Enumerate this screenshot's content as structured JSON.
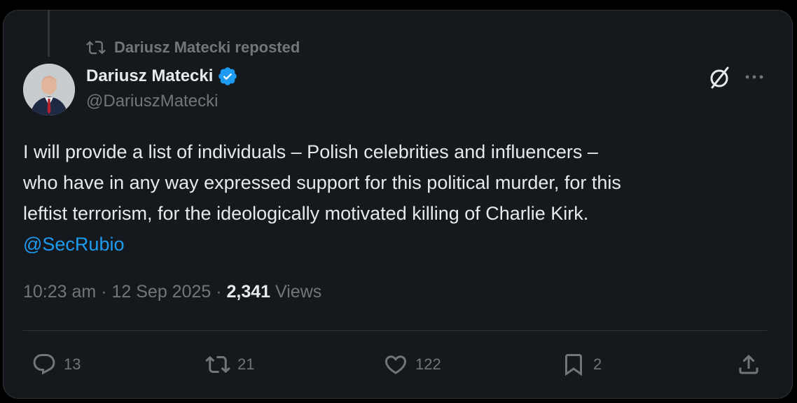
{
  "repost": {
    "label": "Dariusz Matecki reposted",
    "icon": "repost-icon"
  },
  "author": {
    "name": "Dariusz Matecki",
    "handle": "@DariuszMatecki",
    "verified": true,
    "verified_color": "#1d9bf0"
  },
  "tweet": {
    "lines": [
      "I will provide a list of individuals – Polish celebrities and influencers –",
      "who have in any way expressed support for this political murder, for this",
      "leftist terrorism, for the ideologically motivated killing of Charlie Kirk."
    ],
    "mention": "@SecRubio"
  },
  "meta": {
    "time": "10:23 am",
    "separator": "·",
    "date": "12 Sep 2025",
    "views_count": "2,341",
    "views_label": "Views"
  },
  "actions": {
    "replies": "13",
    "reposts": "21",
    "likes": "122",
    "bookmarks": "2"
  },
  "colors": {
    "background": "#15181d",
    "text": "#e7e9ea",
    "muted": "#71767b",
    "accent": "#1d9bf0"
  }
}
